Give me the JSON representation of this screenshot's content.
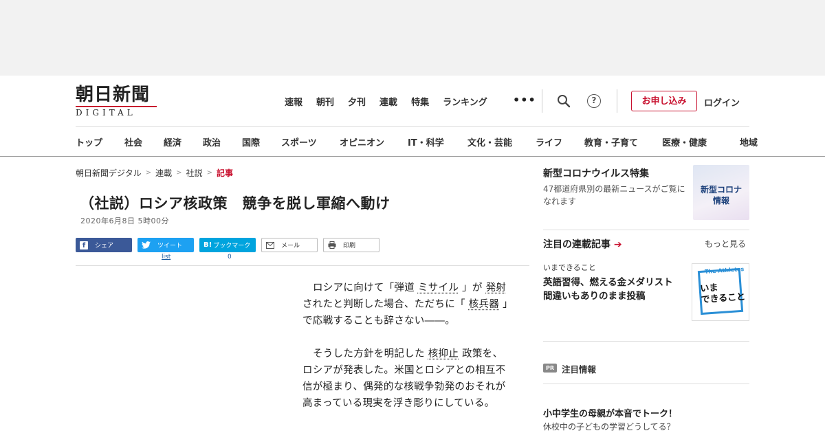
{
  "logo": {
    "main": "朝日新聞",
    "sub": "DIGITAL"
  },
  "top_nav": [
    "速報",
    "朝刊",
    "夕刊",
    "連載",
    "特集",
    "ランキング"
  ],
  "more_dots": "•••",
  "help_mark": "?",
  "apply_button": "お申し込み",
  "login_button": "ログイン",
  "categories": [
    "トップ",
    "社会",
    "経済",
    "政治",
    "国際",
    "スポーツ",
    "オピニオン",
    "IT・科学",
    "文化・芸能",
    "ライフ",
    "教育・子育て",
    "医療・健康",
    "地域"
  ],
  "breadcrumb": {
    "home": "朝日新聞デジタル",
    "level1": "連載",
    "level2": "社説",
    "current": "記事",
    "sep": ">"
  },
  "article": {
    "title": "（社説）ロシア核政策　競争を脱し軍縮へ動け",
    "date": "2020年6月8日 5時00分",
    "p1": {
      "t1": "ロシアに向けて「弾道",
      "k1": "ミサイル",
      "t2": "」が",
      "k2": "発射",
      "t3": "されたと判断した場合、ただちに「",
      "k3": "核兵器",
      "t4": "」で応戦することも辞さない――。"
    },
    "p2": {
      "t1": "そうした方針を明記した",
      "k1": "核抑止",
      "t2": "政策を、ロシアが発表した。米国とロシアとの相互不信が極まり、偶発的な核戦争勃発のおそれが高まっている現実を浮き彫りにしている。"
    }
  },
  "share": {
    "facebook": "シェア",
    "twitter": "ツイート",
    "twitter_list": "list",
    "hatena": "ブックマーク",
    "hatena_count": "0",
    "hatena_icon": "B!",
    "mail": "メール",
    "print": "印刷"
  },
  "sidebar": {
    "corona": {
      "title": "新型コロナウイルス特集",
      "desc": "47都道府県別の最新ニュースがご覧になれます",
      "image_label1": "新型コロナ",
      "image_label2": "情報"
    },
    "series": {
      "heading": "注目の連載記事",
      "more": "もっと見る",
      "item_tag": "いまできること",
      "item_title": "英語習得、燃える金メダリスト　間違いもありのまま投稿",
      "image_label1": "The Athletes",
      "image_label2": "いま",
      "image_label3": "できること"
    },
    "pr": {
      "badge": "PR",
      "heading": "注目情報",
      "item_title": "小中学生の母親が本音でトーク！",
      "item_desc": "休校中の子どもの学習どうしてる？"
    }
  }
}
